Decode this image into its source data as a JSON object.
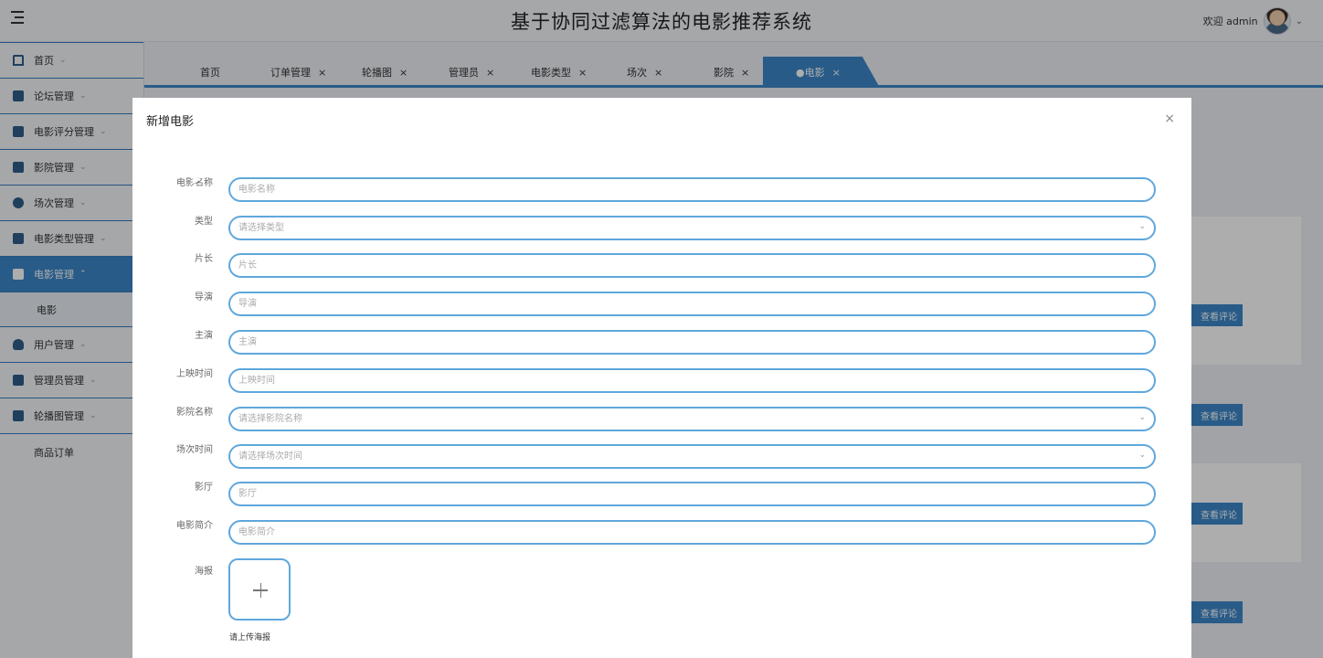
{
  "header": {
    "title": "基于协同过滤算法的电影推荐系统",
    "welcome": "欢迎 admin"
  },
  "sidebar": {
    "items": [
      {
        "label": "首页",
        "icon": "home-icon"
      },
      {
        "label": "论坛管理",
        "icon": "list-icon"
      },
      {
        "label": "电影评分管理",
        "icon": "table-icon"
      },
      {
        "label": "影院管理",
        "icon": "card-icon"
      },
      {
        "label": "场次管理",
        "icon": "dots-icon"
      },
      {
        "label": "电影类型管理",
        "icon": "folder-icon"
      },
      {
        "label": "电影管理",
        "icon": "layout-icon",
        "active": true
      },
      {
        "label": "用户管理",
        "icon": "user-icon"
      },
      {
        "label": "管理员管理",
        "icon": "book-icon"
      },
      {
        "label": "轮播图管理",
        "icon": "image-icon"
      }
    ],
    "sub_item": "电影",
    "plain_item": "商品订单"
  },
  "tabs": [
    {
      "label": "首页",
      "closable": false
    },
    {
      "label": "订单管理",
      "closable": true
    },
    {
      "label": "轮播图",
      "closable": true
    },
    {
      "label": "管理员",
      "closable": true
    },
    {
      "label": "电影类型",
      "closable": true
    },
    {
      "label": "场次",
      "closable": true
    },
    {
      "label": "影院",
      "closable": true
    },
    {
      "label": "●电影",
      "closable": true,
      "active": true
    }
  ],
  "background": {
    "review_button": "查看评论"
  },
  "dialog": {
    "title": "新增电影",
    "close": "×",
    "fields": [
      {
        "label": "电影名称",
        "placeholder": "电影名称",
        "type": "text"
      },
      {
        "label": "类型",
        "placeholder": "请选择类型",
        "type": "select"
      },
      {
        "label": "片长",
        "placeholder": "片长",
        "type": "text"
      },
      {
        "label": "导演",
        "placeholder": "导演",
        "type": "text"
      },
      {
        "label": "主演",
        "placeholder": "主演",
        "type": "text"
      },
      {
        "label": "上映时间",
        "placeholder": "上映时间",
        "type": "text"
      },
      {
        "label": "影院名称",
        "placeholder": "请选择影院名称",
        "type": "select"
      },
      {
        "label": "场次时间",
        "placeholder": "请选择场次时间",
        "type": "select"
      },
      {
        "label": "影厅",
        "placeholder": "影厅",
        "type": "text"
      },
      {
        "label": "电影简介",
        "placeholder": "电影简介",
        "type": "text"
      }
    ],
    "poster_label": "海报",
    "upload_hint": "请上传海报"
  },
  "colors": {
    "accent": "#3b86c9",
    "input_border": "#5fa7dc"
  }
}
